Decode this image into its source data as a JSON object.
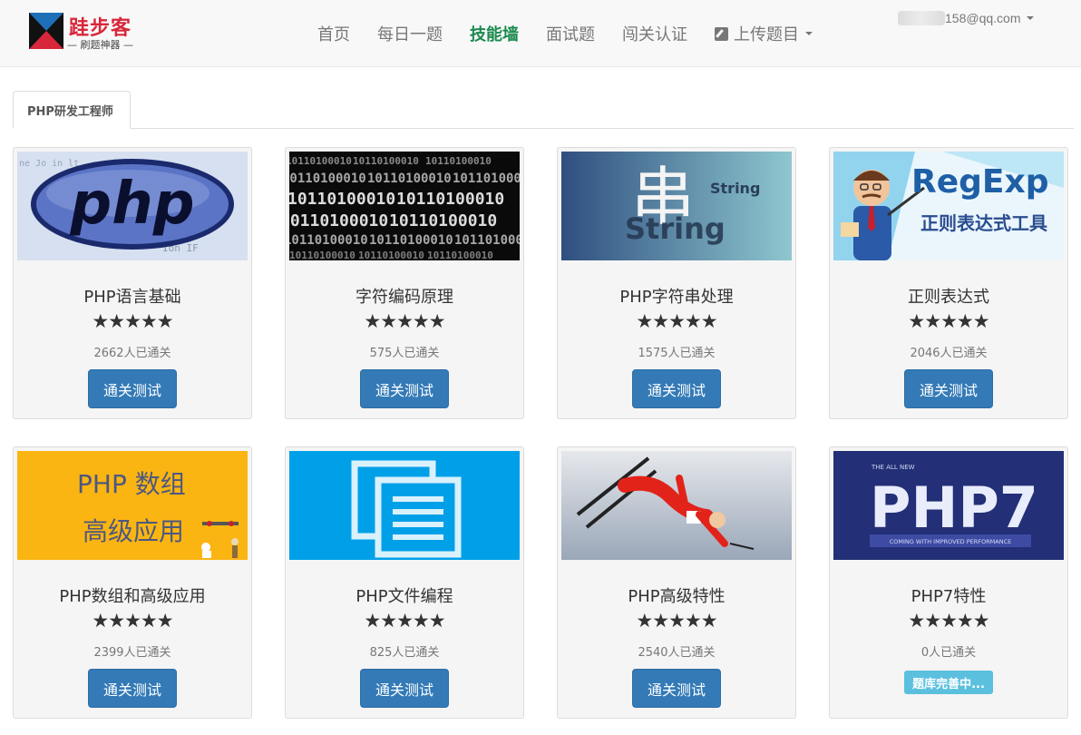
{
  "brand": {
    "name": "跬步客",
    "subtitle": "— 刷题神器 —"
  },
  "nav": {
    "items": [
      {
        "label": "首页",
        "active": false
      },
      {
        "label": "每日一题",
        "active": false
      },
      {
        "label": "技能墙",
        "active": true
      },
      {
        "label": "面试题",
        "active": false
      },
      {
        "label": "闯关认证",
        "active": false
      }
    ],
    "upload_label": "上传题目",
    "upload_icon": "edit-icon"
  },
  "user": {
    "email_suffix": "158@qq.com"
  },
  "tabs": [
    {
      "label": "PHP研发工程师",
      "active": true
    }
  ],
  "cards": [
    {
      "title": "PHP语言基础",
      "stars": 5,
      "stars_text": "★★★★★",
      "passed": "2662人已通关",
      "button": "通关测试",
      "image": "php-logo",
      "image_text": "php"
    },
    {
      "title": "字符编码原理",
      "stars": 5,
      "stars_text": "★★★★★",
      "passed": "575人已通关",
      "button": "通关测试",
      "image": "binary-digits",
      "image_text": "10110100010"
    },
    {
      "title": "PHP字符串处理",
      "stars": 5,
      "stars_text": "★★★★★",
      "passed": "1575人已通关",
      "button": "通关测试",
      "image": "string-graphic",
      "image_text": "String",
      "image_glyph": "串"
    },
    {
      "title": "正则表达式",
      "stars": 5,
      "stars_text": "★★★★★",
      "passed": "2046人已通关",
      "button": "通关测试",
      "image": "regexp-cartoon",
      "image_text": "RegExp",
      "image_subtext": "正则表达式工具"
    },
    {
      "title": "PHP数组和高级应用",
      "stars": 5,
      "stars_text": "★★★★★",
      "passed": "2399人已通关",
      "button": "通关测试",
      "image": "php-array-banner",
      "image_text": "PHP 数组",
      "image_subtext": "高级应用"
    },
    {
      "title": "PHP文件编程",
      "stars": 5,
      "stars_text": "★★★★★",
      "passed": "825人已通关",
      "button": "通关测试",
      "image": "document-copy-icon"
    },
    {
      "title": "PHP高级特性",
      "stars": 5,
      "stars_text": "★★★★★",
      "passed": "2540人已通关",
      "button": "通关测试",
      "image": "aerial-skier-photo"
    },
    {
      "title": "PHP7特性",
      "stars": 5,
      "stars_text": "★★★★★",
      "passed": "0人已通关",
      "button": null,
      "badge": "题库完善中...",
      "image": "php7-banner",
      "image_text": "PHP7",
      "image_toptext": "THE ALL NEW",
      "image_subtext": "COMING WITH IMPROVED PERFORMANCE"
    }
  ],
  "colors": {
    "active_nav": "#1b8a4e",
    "brand_red": "#d8263a",
    "button": "#337ab7",
    "badge": "#5bc0de"
  }
}
